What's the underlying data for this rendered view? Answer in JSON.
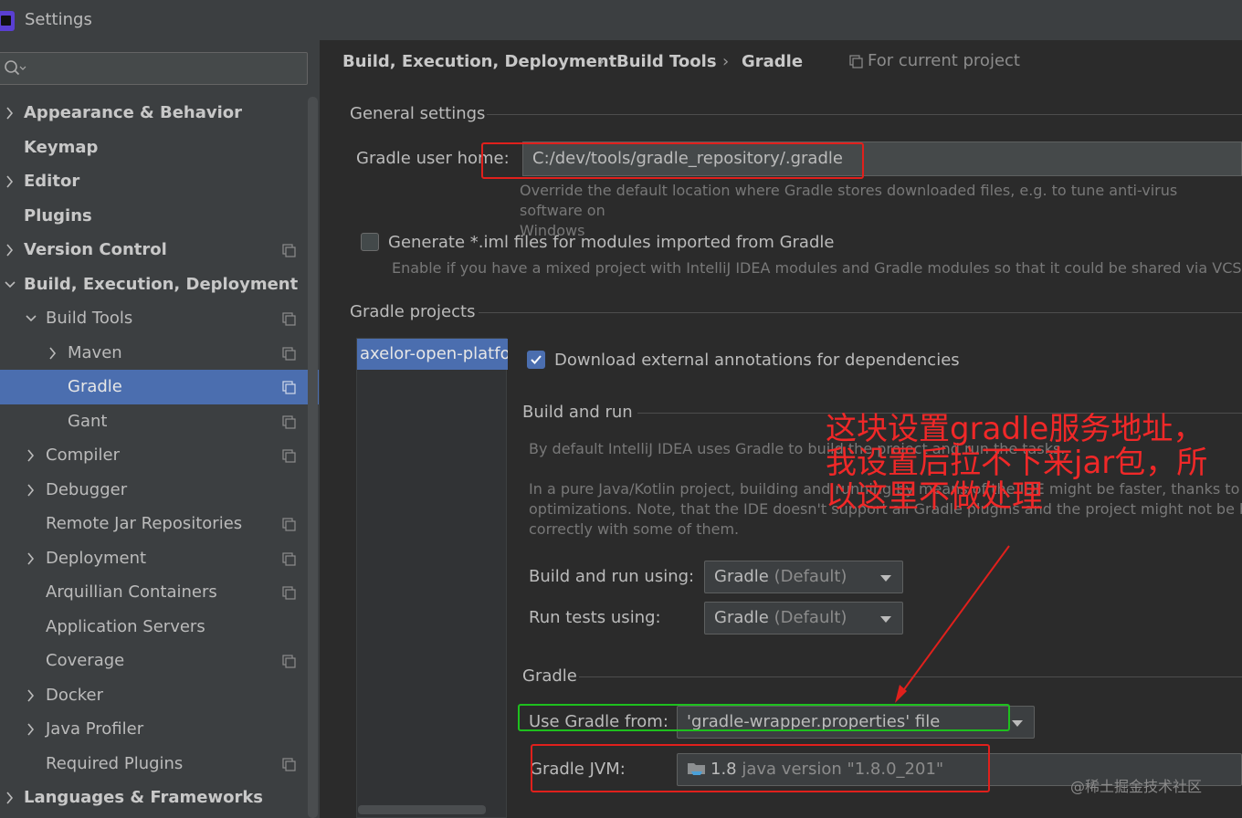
{
  "window": {
    "title": "Settings"
  },
  "search": {
    "placeholder": ""
  },
  "sidebar": {
    "items": [
      {
        "label": "Appearance & Behavior",
        "bold": true,
        "level": 0,
        "arrow": "right",
        "project_icon": false
      },
      {
        "label": "Keymap",
        "bold": true,
        "level": 0,
        "arrow": "none",
        "project_icon": false
      },
      {
        "label": "Editor",
        "bold": true,
        "level": 0,
        "arrow": "right",
        "project_icon": false
      },
      {
        "label": "Plugins",
        "bold": true,
        "level": 0,
        "arrow": "none",
        "project_icon": false
      },
      {
        "label": "Version Control",
        "bold": true,
        "level": 0,
        "arrow": "right",
        "project_icon": true
      },
      {
        "label": "Build, Execution, Deployment",
        "bold": true,
        "level": 0,
        "arrow": "down",
        "project_icon": false
      },
      {
        "label": "Build Tools",
        "bold": false,
        "level": 1,
        "arrow": "down",
        "project_icon": true
      },
      {
        "label": "Maven",
        "bold": false,
        "level": 2,
        "arrow": "right",
        "project_icon": true
      },
      {
        "label": "Gradle",
        "bold": false,
        "level": 2,
        "arrow": "none",
        "project_icon": true,
        "selected": true
      },
      {
        "label": "Gant",
        "bold": false,
        "level": 2,
        "arrow": "none",
        "project_icon": true
      },
      {
        "label": "Compiler",
        "bold": false,
        "level": 1,
        "arrow": "right",
        "project_icon": true
      },
      {
        "label": "Debugger",
        "bold": false,
        "level": 1,
        "arrow": "right",
        "project_icon": false
      },
      {
        "label": "Remote Jar Repositories",
        "bold": false,
        "level": 1,
        "arrow": "none",
        "project_icon": true
      },
      {
        "label": "Deployment",
        "bold": false,
        "level": 1,
        "arrow": "right",
        "project_icon": true
      },
      {
        "label": "Arquillian Containers",
        "bold": false,
        "level": 1,
        "arrow": "none",
        "project_icon": true
      },
      {
        "label": "Application Servers",
        "bold": false,
        "level": 1,
        "arrow": "none",
        "project_icon": false
      },
      {
        "label": "Coverage",
        "bold": false,
        "level": 1,
        "arrow": "none",
        "project_icon": true
      },
      {
        "label": "Docker",
        "bold": false,
        "level": 1,
        "arrow": "right",
        "project_icon": false
      },
      {
        "label": "Java Profiler",
        "bold": false,
        "level": 1,
        "arrow": "right",
        "project_icon": false
      },
      {
        "label": "Required Plugins",
        "bold": false,
        "level": 1,
        "arrow": "none",
        "project_icon": true
      },
      {
        "label": "Languages & Frameworks",
        "bold": true,
        "level": 0,
        "arrow": "right",
        "project_icon": false
      }
    ]
  },
  "breadcrumb": {
    "items": [
      "Build, Execution, Deployment",
      "Build Tools",
      "Gradle"
    ],
    "separator": "›",
    "scope": "For current project"
  },
  "general": {
    "title": "General settings",
    "user_home_label": "Gradle user home:",
    "user_home_value": "C:/dev/tools/gradle_repository/.gradle",
    "user_home_hint_1": "Override the default location where Gradle stores downloaded files, e.g. to tune anti-virus software on",
    "user_home_hint_2": "Windows",
    "iml_label": "Generate *.iml files for modules imported from Gradle",
    "iml_checked": false,
    "iml_hint": "Enable if you have a mixed project with IntelliJ IDEA modules and Gradle modules so that it could be shared via VCS"
  },
  "projects": {
    "title": "Gradle projects",
    "list": [
      "axelor-open-platform"
    ],
    "download_annotations_label": "Download external annotations for dependencies",
    "download_annotations_checked": true
  },
  "build_run": {
    "title": "Build and run",
    "hint_1": "By default IntelliJ IDEA uses Gradle to build the project and run the tasks.",
    "hint_2": "In a pure Java/Kotlin project, building and running by means of the IDE might be faster, thanks to",
    "hint_3": "optimizations. Note, that the IDE doesn't support all Gradle plugins and the project might not be built",
    "hint_4": "correctly with some of them.",
    "build_label": "Build and run using:",
    "build_value": "Gradle",
    "build_suffix": "(Default)",
    "tests_label": "Run tests using:",
    "tests_value": "Gradle",
    "tests_suffix": "(Default)"
  },
  "gradle": {
    "title": "Gradle",
    "use_from_label": "Use Gradle from:",
    "use_from_value": "'gradle-wrapper.properties' file",
    "jvm_label": "Gradle JVM:",
    "jvm_version": "1.8",
    "jvm_detail": "java version \"1.8.0_201\""
  },
  "annotation": {
    "line_1": "这块设置gradle服务地址，",
    "line_2": "我设置后拉不下来jar包，所",
    "line_3": "以这里不做处理"
  },
  "watermark": "@稀土掘金技术社区",
  "colors": {
    "selection": "#4b6eaf",
    "annotation_red": "#e0201c",
    "annotation_green": "#1ec01e",
    "panel_bg": "#2b2b2b",
    "sidebar_bg": "#3c3f41"
  }
}
